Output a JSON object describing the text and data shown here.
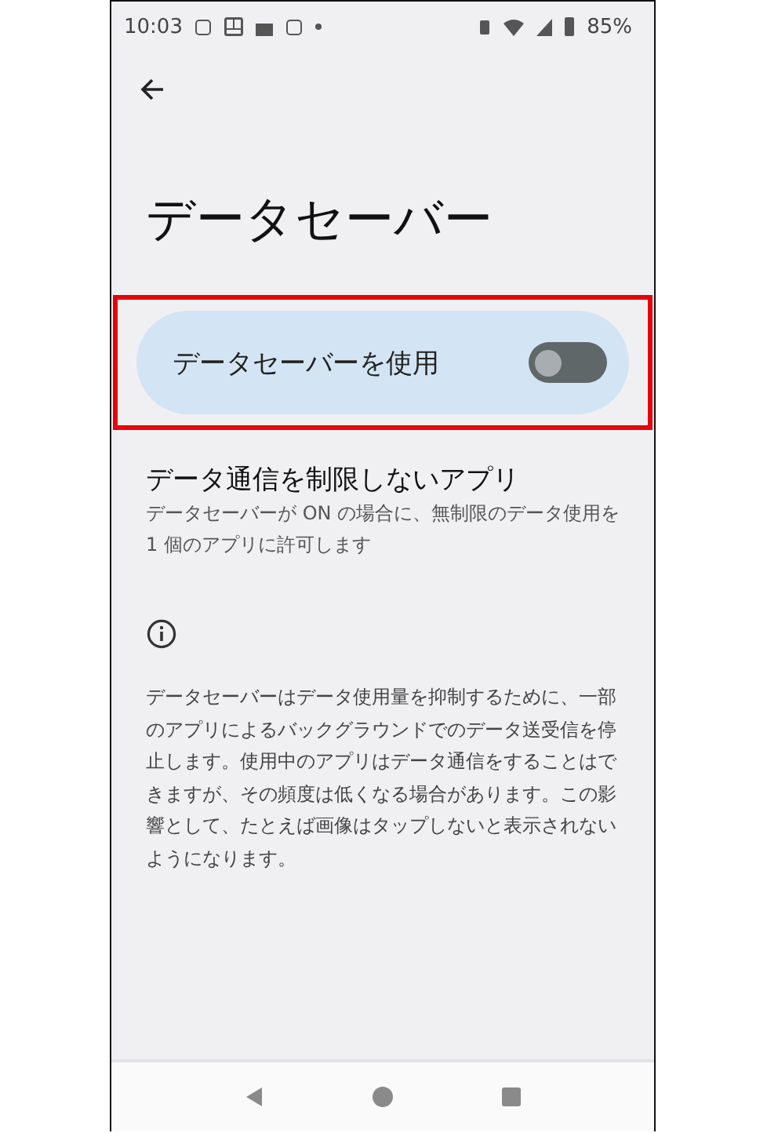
{
  "status_bar": {
    "time": "10:03",
    "battery": "85%"
  },
  "title": "データセーバー",
  "toggle": {
    "label": "データセーバーを使用",
    "on": false,
    "highlighted": true
  },
  "unrestricted": {
    "title": "データ通信を制限しないアプリ",
    "summary": "データセーバーが ON の場合に、無制限のデータ使用を 1 個のアプリに許可します"
  },
  "info": "データセーバーはデータ使用量を抑制するために、一部のアプリによるバックグラウンドでのデータ送受信を停止します。使用中のアプリはデータ通信をすることはできますが、その頻度は低くなる場合があります。この影響として、たとえば画像はタップしないと表示されないようになります。"
}
